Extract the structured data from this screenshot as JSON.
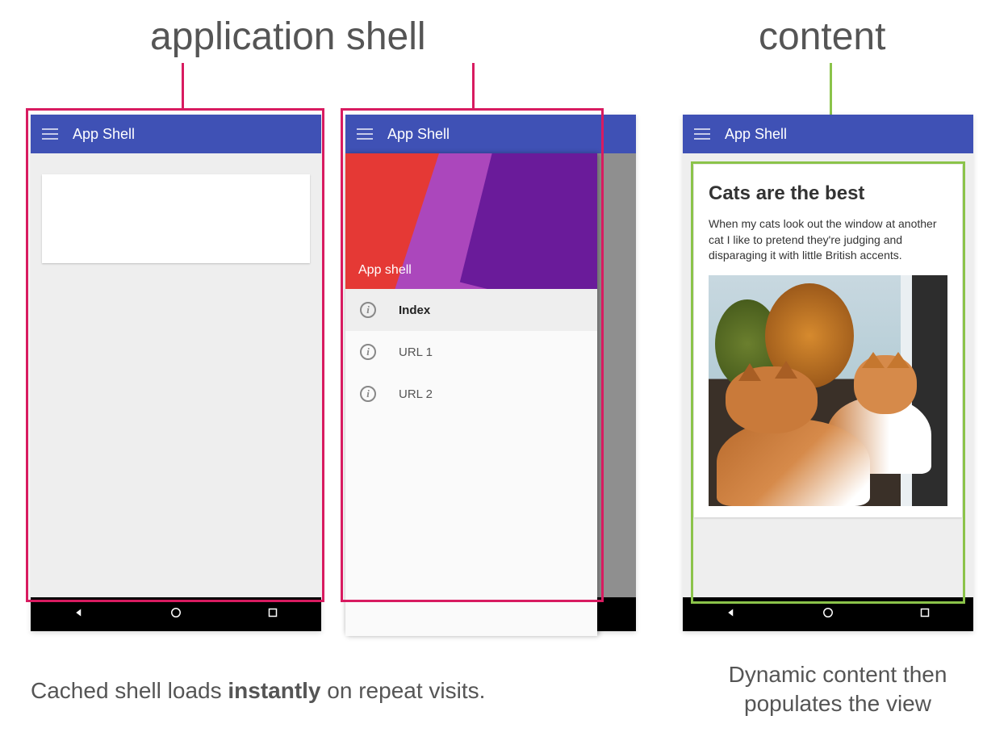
{
  "headings": {
    "shell": "application shell",
    "content": "content"
  },
  "toolbar": {
    "title": "App Shell"
  },
  "drawer": {
    "header_title": "App shell",
    "items": [
      {
        "label": "Index",
        "selected": true
      },
      {
        "label": "URL 1",
        "selected": false
      },
      {
        "label": "URL 2",
        "selected": false
      }
    ]
  },
  "article": {
    "title": "Cats are the best",
    "body": "When my cats look out the window at another cat I like to pretend they're judging and disparaging it with little British accents."
  },
  "captions": {
    "left_pre": "Cached shell loads ",
    "left_strong": "instantly",
    "left_post": " on repeat visits.",
    "right": "Dynamic content then populates the view"
  },
  "colors": {
    "shell_outline": "#d81b60",
    "content_outline": "#8bc34a",
    "toolbar": "#3f51b5"
  }
}
